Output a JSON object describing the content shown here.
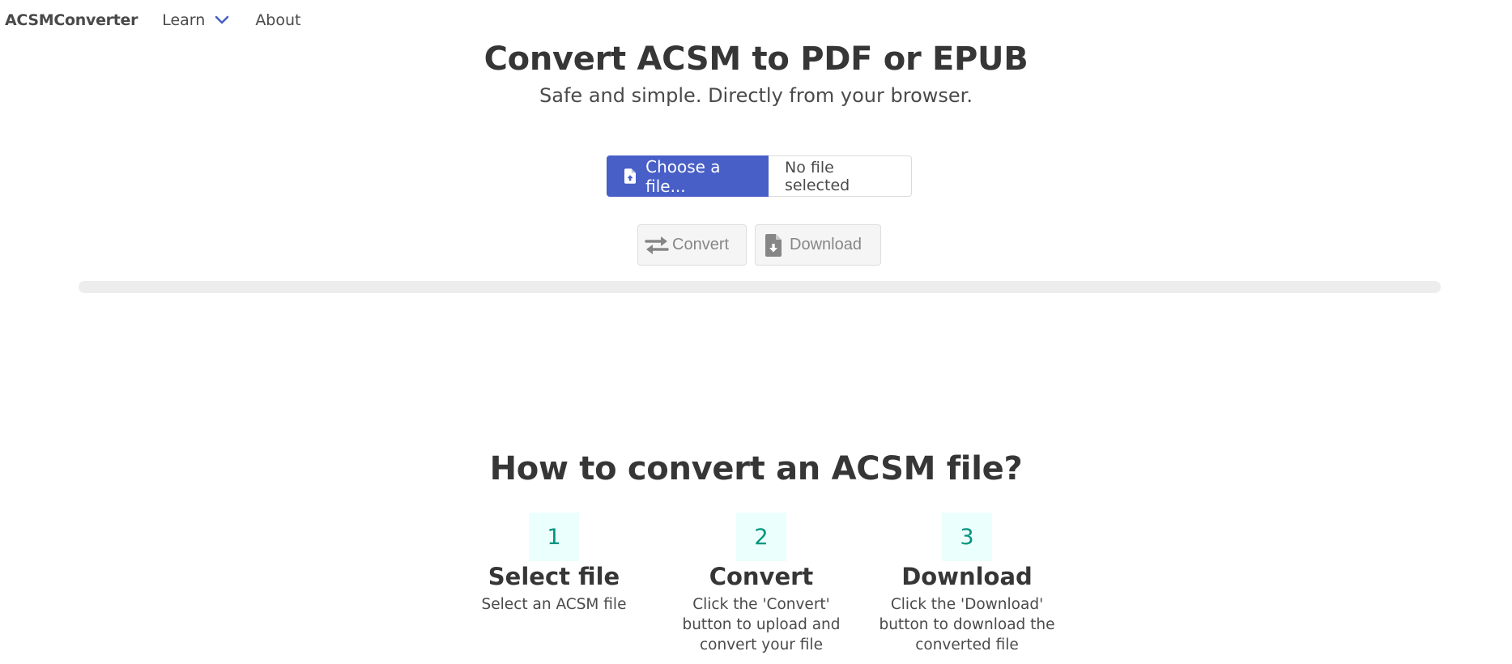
{
  "navbar": {
    "brand": "ACSMConverter",
    "links": [
      {
        "label": "Learn",
        "icon": "chevron-down-icon",
        "has_dropdown": true
      },
      {
        "label": "About"
      }
    ]
  },
  "hero": {
    "title": "Convert ACSM to PDF or EPUB",
    "subtitle": "Safe and simple. Directly from your browser."
  },
  "file_input": {
    "button_label": "Choose a file...",
    "button_icon": "file-upload-icon",
    "file_name": "No file selected"
  },
  "actions": {
    "convert_label": "Convert",
    "convert_icon": "exchange-arrows-icon",
    "download_label": "Download",
    "download_icon": "file-download-icon"
  },
  "progress": {
    "value_percent": 0
  },
  "how_to": {
    "title": "How to convert an ACSM file?",
    "steps": [
      {
        "number": "1",
        "title": "Select file",
        "description": "Select an ACSM file"
      },
      {
        "number": "2",
        "title": "Convert",
        "description": "Click the 'Convert' button to upload and convert your file"
      },
      {
        "number": "3",
        "title": "Download",
        "description": "Click the 'Download' button to download the converted file"
      }
    ]
  },
  "colors": {
    "primary": "#485fc7",
    "step_bg": "#ebfffc",
    "step_text": "#00947e",
    "progress_track": "#ededed"
  }
}
